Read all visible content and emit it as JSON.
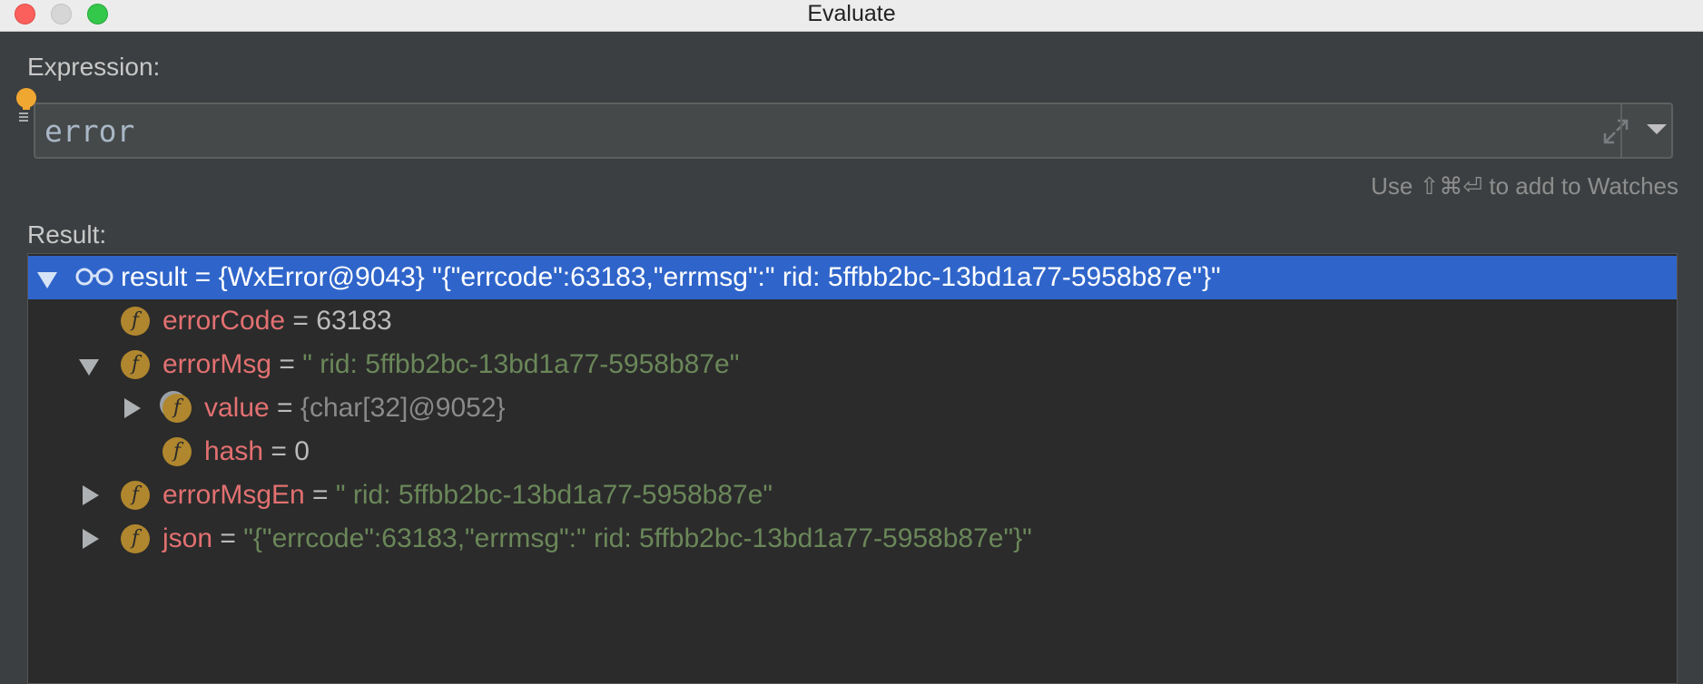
{
  "window": {
    "title": "Evaluate"
  },
  "expression": {
    "label": "Expression:",
    "value": "error",
    "hint": "Use ⇧⌘⏎ to add to Watches"
  },
  "result": {
    "label": "Result:",
    "rows": [
      {
        "name": "result",
        "eq": " = ",
        "value": "{WxError@9043} \"{\"errcode\":63183,\"errmsg\":\" rid: 5ffbb2bc-13bd1a77-5958b87e\"}\""
      },
      {
        "name": "errorCode",
        "eq": " = ",
        "value": "63183"
      },
      {
        "name": "errorMsg",
        "eq": " = ",
        "value": "\" rid: 5ffbb2bc-13bd1a77-5958b87e\""
      },
      {
        "name": "value",
        "eq": " = ",
        "value": "{char[32]@9052}"
      },
      {
        "name": "hash",
        "eq": " = ",
        "value": "0"
      },
      {
        "name": "errorMsgEn",
        "eq": " = ",
        "value": "\" rid: 5ffbb2bc-13bd1a77-5958b87e\""
      },
      {
        "name": "json",
        "eq": " = ",
        "value": "\"{\"errcode\":63183,\"errmsg\":\" rid: 5ffbb2bc-13bd1a77-5958b87e\"}\""
      }
    ]
  },
  "icons": {
    "field": "f"
  },
  "colors": {
    "selection": "#2f65ca",
    "field_name": "#e37071",
    "string": "#6a8759",
    "field_icon": "#b0872e"
  }
}
